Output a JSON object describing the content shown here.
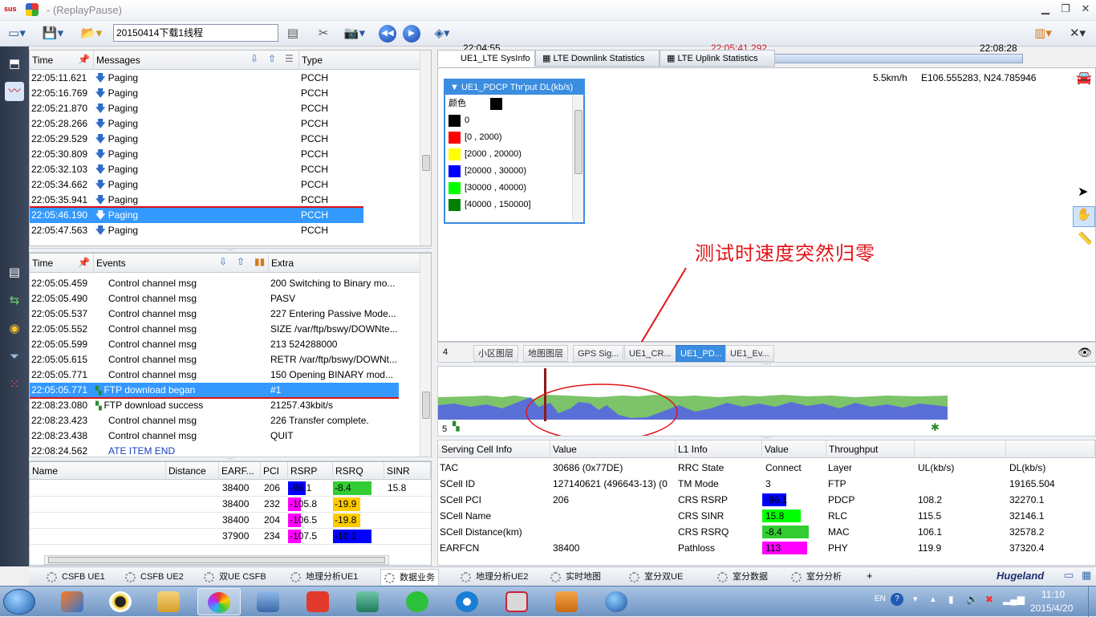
{
  "window": {
    "title": "- (ReplayPause)",
    "app_mark": "sus"
  },
  "toolbar": {
    "file_name": "20150414下载1线程"
  },
  "timeline": {
    "start": "22:04:55",
    "current": "22:05:41.292",
    "end": "22:08:28",
    "position": 0.22
  },
  "messages": {
    "columns": [
      "Time",
      "Messages",
      "Type"
    ],
    "rows": [
      {
        "time": "22:05:11.621",
        "msg": "Paging",
        "type": "PCCH"
      },
      {
        "time": "22:05:16.769",
        "msg": "Paging",
        "type": "PCCH"
      },
      {
        "time": "22:05:21.870",
        "msg": "Paging",
        "type": "PCCH"
      },
      {
        "time": "22:05:28.266",
        "msg": "Paging",
        "type": "PCCH"
      },
      {
        "time": "22:05:29.529",
        "msg": "Paging",
        "type": "PCCH"
      },
      {
        "time": "22:05:30.809",
        "msg": "Paging",
        "type": "PCCH"
      },
      {
        "time": "22:05:32.103",
        "msg": "Paging",
        "type": "PCCH"
      },
      {
        "time": "22:05:34.662",
        "msg": "Paging",
        "type": "PCCH"
      },
      {
        "time": "22:05:35.941",
        "msg": "Paging",
        "type": "PCCH"
      },
      {
        "time": "22:05:46.190",
        "msg": "Paging",
        "type": "PCCH"
      },
      {
        "time": "22:05:47.563",
        "msg": "Paging",
        "type": "PCCH"
      }
    ],
    "selected_index": 9
  },
  "events": {
    "columns": [
      "Time",
      "Events",
      "Extra"
    ],
    "rows": [
      {
        "time": "22:05:05.459",
        "event": "Control channel msg",
        "extra": "200 Switching to Binary mo..."
      },
      {
        "time": "22:05:05.490",
        "event": "Control channel msg",
        "extra": "PASV"
      },
      {
        "time": "22:05:05.537",
        "event": "Control channel msg",
        "extra": "227 Entering Passive Mode..."
      },
      {
        "time": "22:05:05.552",
        "event": "Control channel msg",
        "extra": "SIZE /var/ftp/bswy/DOWNte..."
      },
      {
        "time": "22:05:05.599",
        "event": "Control channel msg",
        "extra": "213 524288000"
      },
      {
        "time": "22:05:05.615",
        "event": "Control channel msg",
        "extra": "RETR /var/ftp/bswy/DOWNt..."
      },
      {
        "time": "22:05:05.771",
        "event": "Control channel msg",
        "extra": "150 Opening BINARY mod..."
      },
      {
        "time": "22:05:05.771",
        "event": "FTP download began",
        "extra": "#1"
      },
      {
        "time": "22:08:23.080",
        "event": "FTP download success",
        "extra": "21257.43kbit/s"
      },
      {
        "time": "22:08:23.423",
        "event": "Control channel msg",
        "extra": "226 Transfer complete."
      },
      {
        "time": "22:08:23.438",
        "event": "Control channel msg",
        "extra": "QUIT"
      },
      {
        "time": "22:08:24.562",
        "event": "ATE ITEM END",
        "extra": ""
      }
    ],
    "selected_index": 7
  },
  "neighbors": {
    "columns": [
      "Name",
      "Distance",
      "EARF...",
      "PCI",
      "RSRP",
      "RSRQ",
      "SINR"
    ],
    "rows": [
      {
        "earfcn": "38400",
        "pci": "206",
        "rsrp": "-96.1",
        "rsrq": "-8.4",
        "sinr": "15.8",
        "rsrp_color": "#0000ff",
        "rsrq_color": "#33cc33"
      },
      {
        "earfcn": "38400",
        "pci": "232",
        "rsrp": "-105.8",
        "rsrq": "-19.9",
        "sinr": "",
        "rsrp_color": "#ff00ff",
        "rsrq_color": "#ffcc00"
      },
      {
        "earfcn": "38400",
        "pci": "204",
        "rsrp": "-106.5",
        "rsrq": "-19.8",
        "sinr": "",
        "rsrp_color": "#ff00ff",
        "rsrq_color": "#ffcc00"
      },
      {
        "earfcn": "37900",
        "pci": "234",
        "rsrp": "-107.5",
        "rsrq": "-10.1",
        "sinr": "",
        "rsrp_color": "#ff00ff",
        "rsrq_color": "#0000ff"
      }
    ]
  },
  "tabs": [
    "UE1_LTE SysInfo",
    "LTE Downlink Statistics",
    "LTE Uplink Statistics"
  ],
  "map": {
    "speed": "5.5km/h",
    "coords": "E106.555283, N24.785946"
  },
  "legend": {
    "title": "UE1_PDCP Thr'put DL(kb/s)",
    "header": "颜色",
    "items": [
      {
        "label": "0",
        "color": "#000000"
      },
      {
        "label": "[0 , 2000)",
        "color": "#ff0000"
      },
      {
        "label": "[2000 , 20000)",
        "color": "#ffff00"
      },
      {
        "label": "[20000 , 30000)",
        "color": "#0000ff"
      },
      {
        "label": "[30000 , 40000)",
        "color": "#00ff00"
      },
      {
        "label": "[40000 , 150000]",
        "color": "#008000"
      }
    ]
  },
  "annotation": "测试时速度突然归零",
  "layers": {
    "count": "4",
    "tabs": [
      "小区图层",
      "地图图层",
      "GPS Sig...",
      "UE1_CR...",
      "UE1_PD...",
      "UE1_Ev..."
    ],
    "active_index": 4
  },
  "chart_panel": {
    "count": "5"
  },
  "info": {
    "headers": [
      "Serving Cell Info",
      "Value",
      "L1 Info",
      "Value",
      "Throughput",
      "",
      ""
    ],
    "serving": [
      {
        "k": "TAC",
        "v": "30686 (0x77DE)"
      },
      {
        "k": "SCell ID",
        "v": "127140621 (496643-13) (0"
      },
      {
        "k": "SCell PCI",
        "v": "206"
      },
      {
        "k": "SCell Name",
        "v": ""
      },
      {
        "k": "SCell Distance(km)",
        "v": ""
      },
      {
        "k": "EARFCN",
        "v": "38400"
      }
    ],
    "l1": [
      {
        "k": "RRC State",
        "v": "Connect",
        "color": ""
      },
      {
        "k": "TM Mode",
        "v": "3",
        "color": ""
      },
      {
        "k": "CRS RSRP",
        "v": "-96.1",
        "color": "#0000ff"
      },
      {
        "k": "CRS SINR",
        "v": "15.8",
        "color": "#00ff00"
      },
      {
        "k": "CRS RSRQ",
        "v": "-8.4",
        "color": "#33cc33"
      },
      {
        "k": "Pathloss",
        "v": "113",
        "color": "#ff00ff"
      }
    ],
    "throughput_header": [
      "Layer",
      "UL(kb/s)",
      "DL(kb/s)"
    ],
    "throughput": [
      {
        "layer": "FTP",
        "ul": "",
        "dl": "19165.504"
      },
      {
        "layer": "PDCP",
        "ul": "108.2",
        "dl": "32270.1"
      },
      {
        "layer": "RLC",
        "ul": "115.5",
        "dl": "32146.1"
      },
      {
        "layer": "MAC",
        "ul": "106.1",
        "dl": "32578.2"
      },
      {
        "layer": "PHY",
        "ul": "119.9",
        "dl": "37320.4"
      }
    ]
  },
  "bottom_tabs": [
    "CSFB UE1",
    "CSFB UE2",
    "双UE  CSFB",
    "地理分析UE1",
    "数据业务",
    "地理分析UE2",
    "实时地图",
    "室分双UE",
    "室分数据",
    "室分分析"
  ],
  "bottom_active": 4,
  "brand": "Hugeland",
  "clock": {
    "time": "11:10",
    "date": "2015/4/20",
    "lang": "EN"
  },
  "colors": {
    "selection": "#3399ff",
    "accent": "#3a8de0",
    "annotation": "#e1141a"
  }
}
